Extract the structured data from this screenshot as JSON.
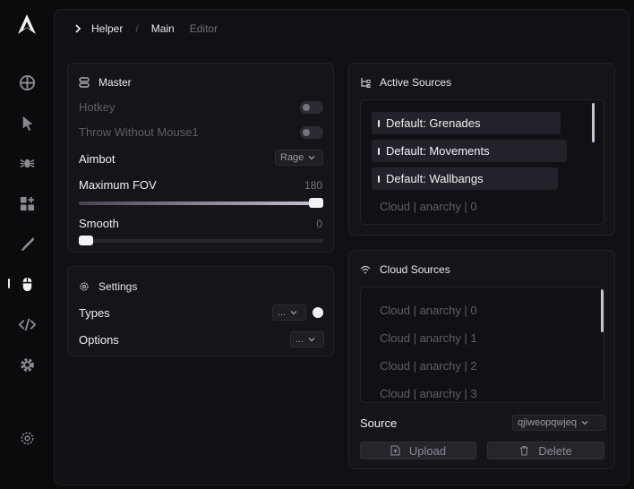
{
  "sidebar": {
    "logo": "logo-mark",
    "items": [
      {
        "icon": "wheel-icon"
      },
      {
        "icon": "cursor-icon"
      },
      {
        "icon": "bug-icon"
      },
      {
        "icon": "widgets-icon"
      },
      {
        "icon": "knife-icon"
      },
      {
        "icon": "mouse-icon",
        "active": true
      },
      {
        "icon": "code-icon"
      },
      {
        "icon": "gear-icon"
      }
    ],
    "bottom_icon": "settings-icon"
  },
  "breadcrumb": {
    "items": [
      "Helper",
      "Main"
    ],
    "current": "Editor"
  },
  "master": {
    "title": "Master",
    "hotkey_label": "Hotkey",
    "throw_label": "Throw Without Mouse1",
    "aimbot_label": "Aimbot",
    "aimbot_value": "Rage",
    "fov_label": "Maximum FOV",
    "fov_value": "180",
    "fov_fraction": 1.0,
    "smooth_label": "Smooth",
    "smooth_value": "0",
    "smooth_fraction": 0.0
  },
  "settings": {
    "title": "Settings",
    "types_label": "Types",
    "types_value": "...",
    "options_label": "Options",
    "options_value": "..."
  },
  "active_sources": {
    "title": "Active Sources",
    "items": [
      {
        "label": "Default: Grenades",
        "active": true
      },
      {
        "label": "Default: Movements",
        "active": true
      },
      {
        "label": "Default: Wallbangs",
        "active": true
      },
      {
        "label": "Cloud | anarchy | 0",
        "active": false
      }
    ]
  },
  "cloud_sources": {
    "title": "Cloud Sources",
    "items": [
      "Cloud | anarchy | 0",
      "Cloud | anarchy | 1",
      "Cloud | anarchy | 2",
      "Cloud | anarchy | 3"
    ],
    "source_label": "Source",
    "source_value": "qjiweopqwjeq",
    "upload_label": "Upload",
    "delete_label": "Delete"
  },
  "colors": {
    "background": "#0b0b0e",
    "panel": "#151519",
    "text": "#e8e8ee",
    "muted": "#5e5e68",
    "accent_gradient_end": "#c9bfd6"
  }
}
